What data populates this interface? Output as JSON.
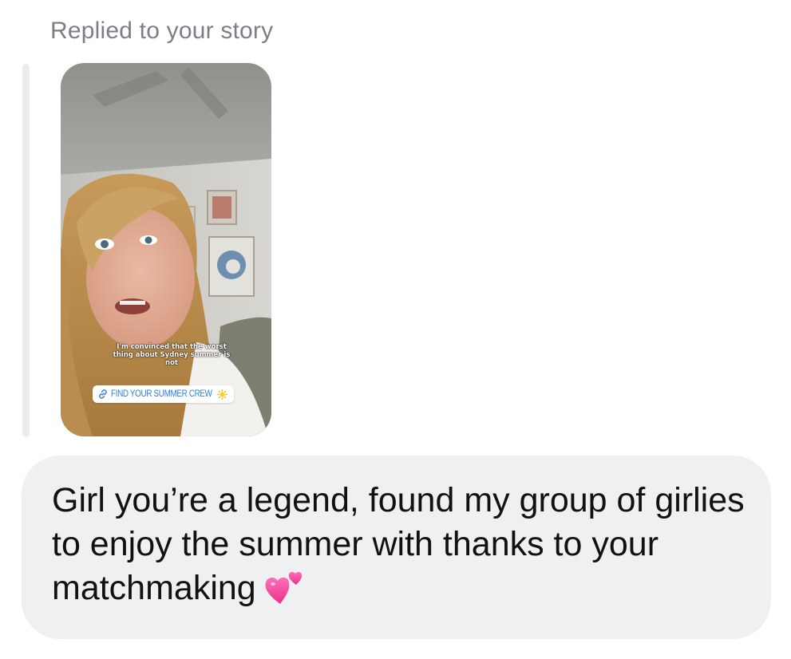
{
  "reply_header": "Replied to your story",
  "story": {
    "caption": "I'm convinced that the worst thing about Sydney summer is not",
    "link_sticker_label": "FIND YOUR SUMMER CREW",
    "link_icon": "link-icon",
    "sticker_emoji_icon": "sun-icon"
  },
  "message": {
    "text": "Girl you’re a legend, found my group of girlies to enjoy the summer with thanks to your matchmaking",
    "emoji_icon": "two-hearts-icon"
  },
  "colors": {
    "header_text": "#7c7f85",
    "bubble_background": "#eef0f2",
    "message_text": "#111111",
    "link_text": "#2f7fd6",
    "heart": "#f0479b"
  }
}
